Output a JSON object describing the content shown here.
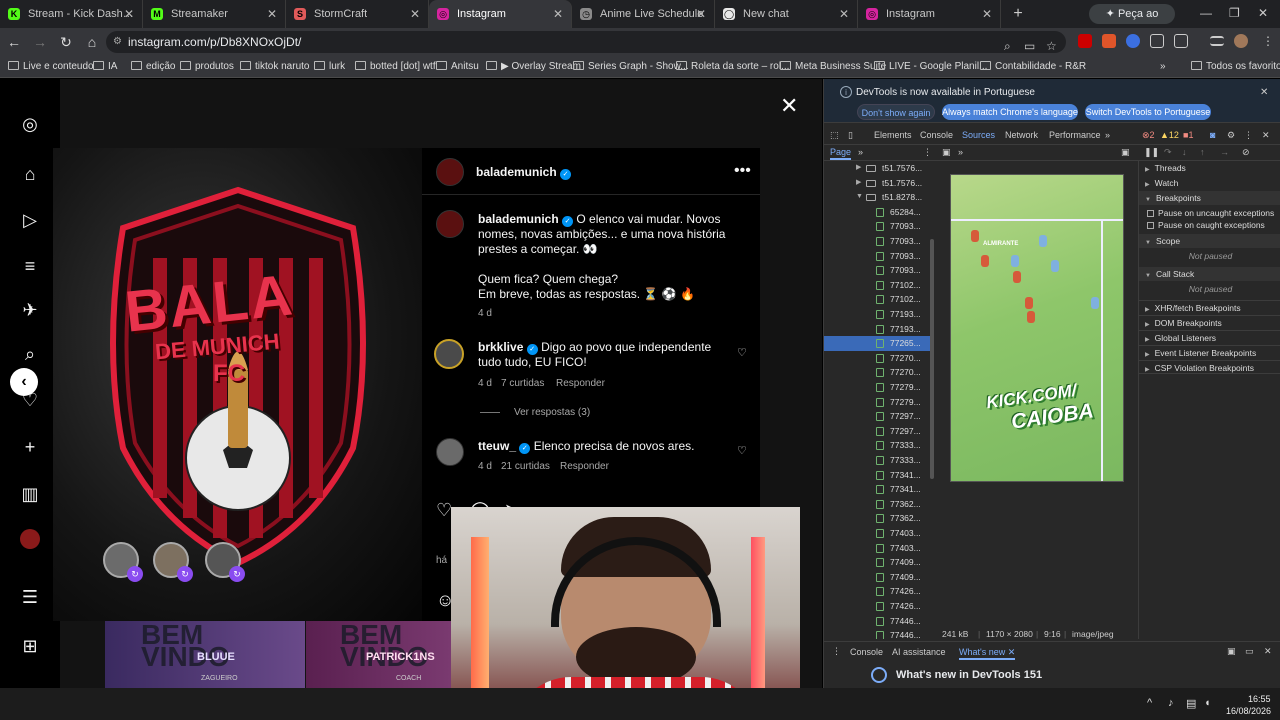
{
  "browser": {
    "tabs": [
      {
        "label": "Stream - Kick Dashboard",
        "icon": "kick-icon",
        "color": "#53fc18",
        "glyph": "K"
      },
      {
        "label": "Streamaker",
        "icon": "streamaker-icon",
        "color": "#53fc18",
        "glyph": "M"
      },
      {
        "label": "StormCraft",
        "icon": "stormcraft-icon",
        "color": "#e05a5a",
        "glyph": "S"
      },
      {
        "label": "Instagram",
        "icon": "instagram-icon",
        "color": "#d6249f",
        "glyph": "◎",
        "active": true
      },
      {
        "label": "Anime Live Schedule",
        "icon": "anime-icon",
        "color": "#8a8a8a",
        "glyph": "◷"
      },
      {
        "label": "New chat",
        "icon": "chat-icon",
        "color": "#e8e8e8",
        "glyph": "◯"
      },
      {
        "label": "Instagram",
        "icon": "instagram-icon",
        "color": "#d6249f",
        "glyph": "◎"
      }
    ],
    "gemini_label": "Peça ao Gemini",
    "url": "instagram.com/p/Db8XNOxOjDt/",
    "bookmarks": [
      "Live e conteudo",
      "IA",
      "edição",
      "produtos",
      "tiktok naruto",
      "lurk",
      "botted [dot] wtf",
      "Anitsu",
      "▶ Overlay Stream",
      "Series Graph - Show...",
      "Roleta da sorte – rol...",
      "Meta Business Suite",
      "LIVE - Google Planil...",
      "Contabilidade - R&R"
    ],
    "bookmarks_all": "Todos os favoritos"
  },
  "post": {
    "image_text": {
      "line1": "BALA",
      "line2": "DE MUNICH",
      "line3": "FC"
    },
    "author": "balademunich",
    "more_icon": "more-icon",
    "caption": {
      "line1": "O elenco vai mudar. Novos",
      "line2": "nomes, novas ambições... e uma nova história",
      "line3": "prestes a começar. 👀",
      "line4": "Quem fica? Quem chega?",
      "line5": "Em breve, todas as respostas. ⏳ ⚽ 🔥",
      "age": "4 d"
    },
    "comments": [
      {
        "user": "brkklive",
        "text1": "Digo ao povo que independente",
        "text2": "tudo tudo, EU FICO!",
        "age": "4 d",
        "likes": "7 curtidas",
        "reply": "Responder"
      },
      {
        "user": "tteuw_",
        "text1": "Elenco precisa de novos ares.",
        "age": "4 d",
        "likes": "21 curtidas",
        "reply": "Responder"
      }
    ],
    "view_replies": "Ver respostas (3)",
    "time_partial": "há",
    "below_cards": [
      "BEM",
      "VINDO",
      "BLUUE",
      "ZAGUEIRO",
      "BEM",
      "VINDO",
      "PATRICK1NS",
      "COACH"
    ]
  },
  "devtools": {
    "banner_text": "DevTools is now available in Portuguese",
    "btn_dont_show": "Don't show again",
    "btn_match": "Always match Chrome's language",
    "btn_switch": "Switch DevTools to Portuguese",
    "tabs": [
      "Elements",
      "Console",
      "Sources",
      "Network",
      "Performance"
    ],
    "active_tab": "Sources",
    "counts": {
      "errors": "2",
      "warnings": "12",
      "issues": "1"
    },
    "sub_tab": "Page",
    "files": [
      {
        "label": "t51.7576...",
        "folder": true
      },
      {
        "label": "t51.7576...",
        "folder": true
      },
      {
        "label": "t51.8278...",
        "folder": true,
        "open": true
      },
      {
        "label": "65284..."
      },
      {
        "label": "77093..."
      },
      {
        "label": "77093..."
      },
      {
        "label": "77093..."
      },
      {
        "label": "77093..."
      },
      {
        "label": "77102..."
      },
      {
        "label": "77102..."
      },
      {
        "label": "77193..."
      },
      {
        "label": "77193..."
      },
      {
        "label": "77265...",
        "selected": true
      },
      {
        "label": "77270..."
      },
      {
        "label": "77270..."
      },
      {
        "label": "77279..."
      },
      {
        "label": "77279..."
      },
      {
        "label": "77297..."
      },
      {
        "label": "77297..."
      },
      {
        "label": "77333..."
      },
      {
        "label": "77333..."
      },
      {
        "label": "77341..."
      },
      {
        "label": "77341..."
      },
      {
        "label": "77362..."
      },
      {
        "label": "77362..."
      },
      {
        "label": "77403..."
      },
      {
        "label": "77403..."
      },
      {
        "label": "77409..."
      },
      {
        "label": "77409..."
      },
      {
        "label": "77426..."
      },
      {
        "label": "77426..."
      },
      {
        "label": "77446..."
      },
      {
        "label": "77446..."
      }
    ],
    "preview_overlay_1": "KICK.COM/",
    "preview_overlay_2": "CAIOBA",
    "preview_player_tag": "ALMIRANTE",
    "image_info": {
      "size": "241 kB",
      "dims": "1170 × 2080",
      "ratio": "9:16",
      "type": "image/jpeg"
    },
    "debugger": {
      "threads": "Threads",
      "watch": "Watch",
      "breakpoints": "Breakpoints",
      "pause_uncaught": "Pause on uncaught exceptions",
      "pause_caught": "Pause on caught exceptions",
      "scope": "Scope",
      "not_paused_1": "Not paused",
      "call_stack": "Call Stack",
      "not_paused_2": "Not paused",
      "xhr": "XHR/fetch Breakpoints",
      "dom": "DOM Breakpoints",
      "global": "Global Listeners",
      "event": "Event Listener Breakpoints",
      "csp": "CSP Violation Breakpoints"
    },
    "drawer_tabs": [
      "Console",
      "AI assistance",
      "What's new"
    ],
    "whats_new": "What's new in DevTools 151"
  },
  "taskbar": {
    "time": "16:55",
    "date": "16/08/2026"
  }
}
